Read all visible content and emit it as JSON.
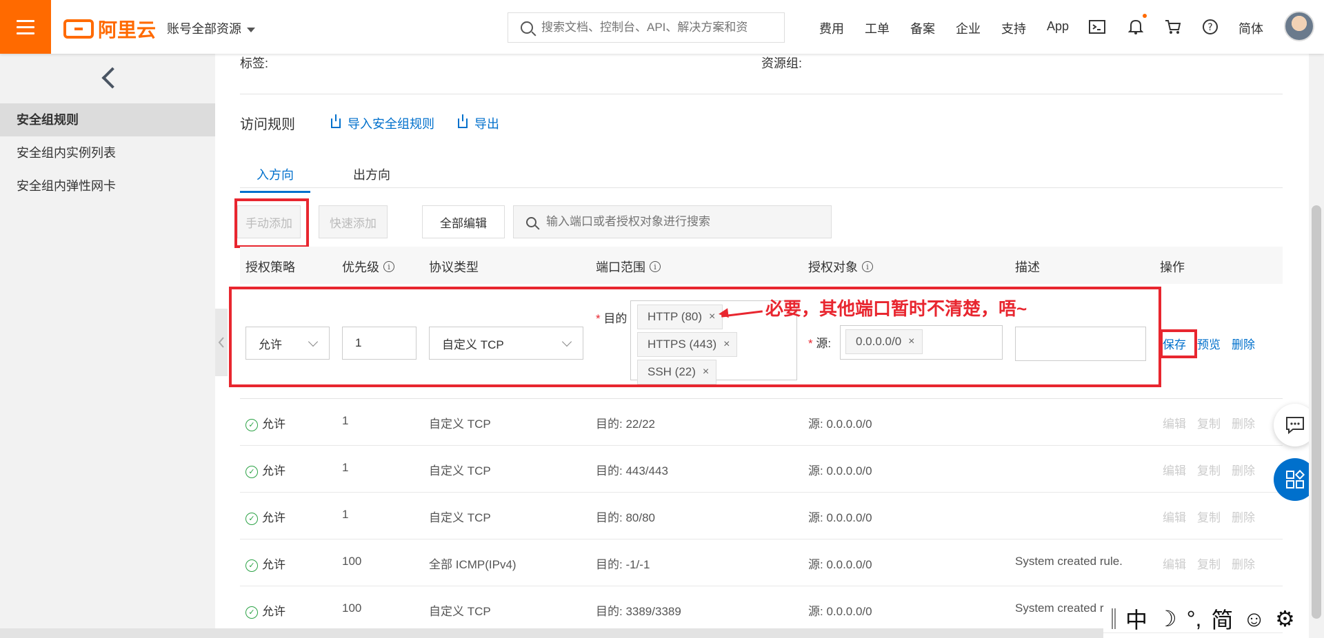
{
  "topbar": {
    "logo": "阿里云",
    "account_menu": "账号全部资源",
    "search_placeholder": "搜索文档、控制台、API、解决方案和资",
    "nav": [
      "费用",
      "工单",
      "备案",
      "企业",
      "支持",
      "App"
    ],
    "lang": "简体"
  },
  "sidebar": {
    "items": [
      "安全组规则",
      "安全组内实例列表",
      "安全组内弹性网卡"
    ]
  },
  "info": {
    "tags_label": "标签:",
    "resource_group_label": "资源组:"
  },
  "rules": {
    "title": "访问规则",
    "import_label": "导入安全组规则",
    "export_label": "导出",
    "tabs": [
      "入方向",
      "出方向"
    ],
    "buttons": {
      "manual_add": "手动添加",
      "quick_add": "快速添加",
      "edit_all": "全部编辑"
    },
    "filter_placeholder": "输入端口或者授权对象进行搜索",
    "columns": [
      "授权策略",
      "优先级",
      "协议类型",
      "端口范围",
      "授权对象",
      "描述",
      "操作"
    ],
    "edit_row": {
      "policy": "允许",
      "priority": "1",
      "protocol": "自定义 TCP",
      "port_label": "目的",
      "port_tags": [
        "HTTP (80)",
        "HTTPS (443)",
        "SSH (22)"
      ],
      "source_label": "源:",
      "source_tags": [
        "0.0.0.0/0"
      ],
      "actions": [
        "保存",
        "预览",
        "删除"
      ]
    },
    "annotation": "必要，其他端口暂时不清楚，唔~",
    "rows": [
      {
        "policy": "允许",
        "priority": "1",
        "protocol": "自定义 TCP",
        "port": "目的: 22/22",
        "source": "源: 0.0.0.0/0",
        "desc": ""
      },
      {
        "policy": "允许",
        "priority": "1",
        "protocol": "自定义 TCP",
        "port": "目的: 443/443",
        "source": "源: 0.0.0.0/0",
        "desc": ""
      },
      {
        "policy": "允许",
        "priority": "1",
        "protocol": "自定义 TCP",
        "port": "目的: 80/80",
        "source": "源: 0.0.0.0/0",
        "desc": ""
      },
      {
        "policy": "允许",
        "priority": "100",
        "protocol": "全部 ICMP(IPv4)",
        "port": "目的: -1/-1",
        "source": "源: 0.0.0.0/0",
        "desc": "System created rule."
      },
      {
        "policy": "允许",
        "priority": "100",
        "protocol": "自定义 TCP",
        "port": "目的: 3389/3389",
        "source": "源: 0.0.0.0/0",
        "desc": "System created r"
      }
    ],
    "row_actions": [
      "编辑",
      "复制",
      "删除"
    ]
  },
  "ime": {
    "items": [
      "中",
      "☽",
      "°,",
      "简",
      "☺",
      "⚙"
    ]
  },
  "colors": {
    "brand": "#ff6a00",
    "link": "#0070cc",
    "highlight": "#e8262f"
  }
}
